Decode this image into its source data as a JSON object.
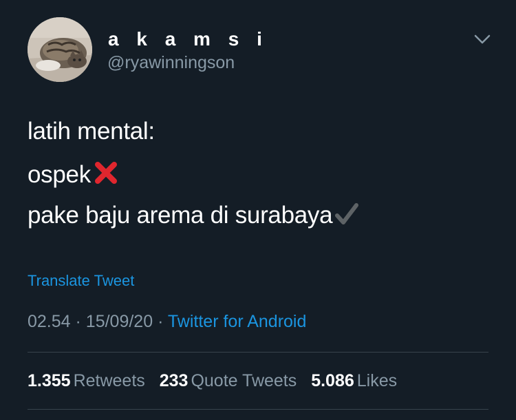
{
  "user": {
    "display_name": "a k a m s i",
    "handle": "@ryawinningson"
  },
  "avatar_icon": "cat-photo-avatar",
  "tweet": {
    "lines": [
      "latih mental:",
      "ospek",
      "pake baju arema di surabaya"
    ],
    "line2_emoji": "cross-mark-icon",
    "line3_emoji": "check-mark-icon"
  },
  "translate_label": "Translate Tweet",
  "meta": {
    "time": "02.54",
    "separator": "·",
    "date": "15/09/20",
    "source": "Twitter for Android"
  },
  "stats": [
    {
      "value": "1.355",
      "label": "Retweets"
    },
    {
      "value": "233",
      "label": "Quote Tweets"
    },
    {
      "value": "5.086",
      "label": "Likes"
    }
  ],
  "colors": {
    "background": "#141d26",
    "text": "#ffffff",
    "secondary": "#8899a6",
    "link": "#1b95e0",
    "divider": "#38444d",
    "cross": "#e0262e"
  }
}
